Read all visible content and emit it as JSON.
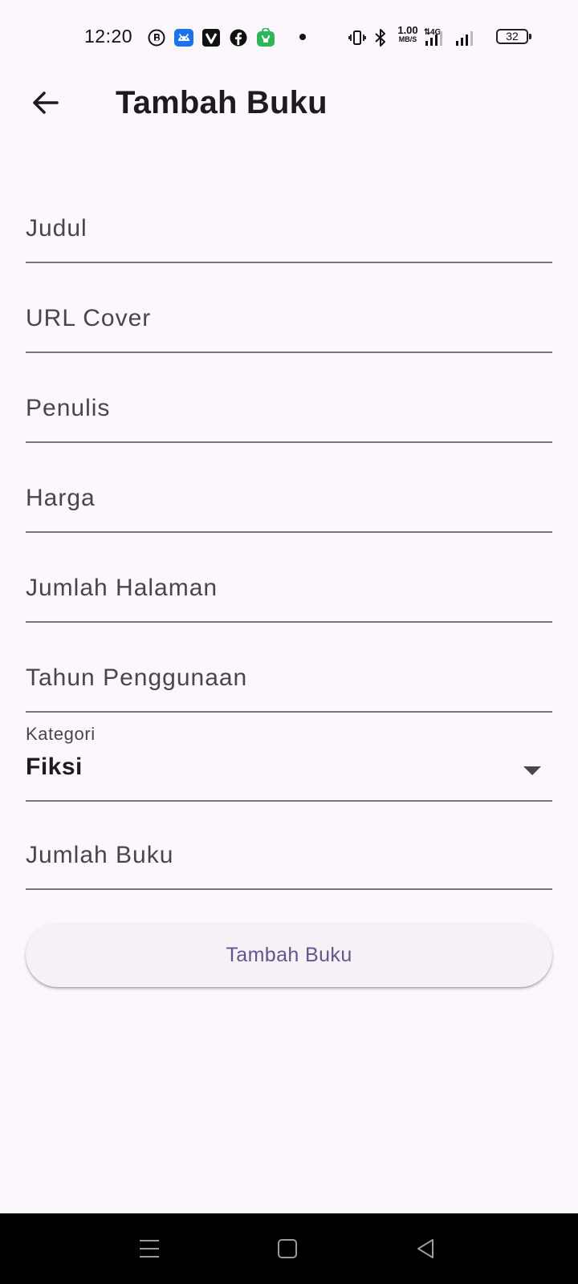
{
  "status_bar": {
    "time": "12:20",
    "net_speed": "1.00",
    "net_unit": "MB/S",
    "network_type": "4G",
    "battery": "32",
    "icons": [
      "bbm-icon",
      "android-icon",
      "vivo-icon",
      "facebook-icon",
      "shopping-bag-icon",
      "notification-dot",
      "vibrate-icon",
      "bluetooth-icon",
      "signal-icon",
      "signal-icon",
      "battery-icon"
    ]
  },
  "app_bar": {
    "back_icon": "arrow-left-icon",
    "title": "Tambah Buku"
  },
  "form": {
    "fields": [
      {
        "label": "Judul"
      },
      {
        "label": "URL Cover"
      },
      {
        "label": "Penulis"
      },
      {
        "label": "Harga"
      },
      {
        "label": "Jumlah Halaman"
      },
      {
        "label": "Tahun Penggunaan"
      }
    ],
    "category": {
      "label": "Kategori",
      "selected": "Fiksi",
      "icon": "dropdown-arrow-icon"
    },
    "quantity_field": {
      "label": "Jumlah Buku"
    },
    "submit_label": "Tambah Buku"
  },
  "nav_bar": {
    "icons": [
      "menu-icon",
      "home-icon",
      "back-icon"
    ]
  },
  "colors": {
    "background": "#fcf7fc",
    "primary": "#65558f",
    "underline": "#79747e",
    "label": "#49454f",
    "text": "#1d1b20",
    "button_bg": "#f6f1f6",
    "nav_bg": "#000000"
  }
}
